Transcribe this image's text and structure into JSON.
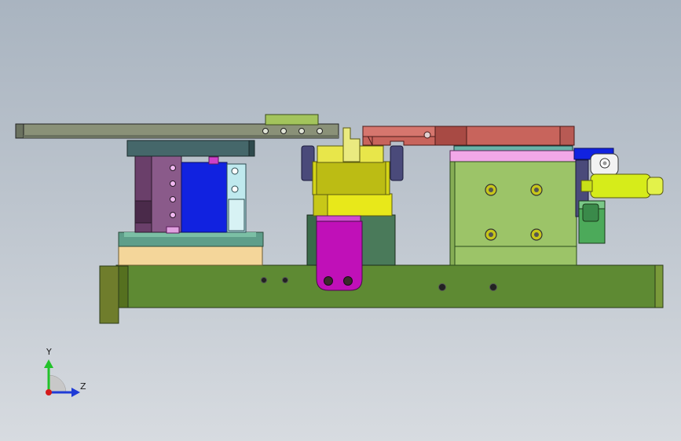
{
  "view": {
    "background_top": "#a9b4c0",
    "background_bottom": "#d7dbe0"
  },
  "triad": {
    "y_label": "Y",
    "z_label": "Z",
    "y_color": "#22c22a",
    "z_color": "#1f3bd6",
    "x_color": "#d41b1b"
  },
  "colors": {
    "base_beam": "#5e8a33",
    "end_block": "#6f7d2c",
    "top_rail": "#8a9178",
    "right_arm": "#c8645c",
    "purple_block": "#6a3f6a",
    "blue_block": "#1122e0",
    "cyan_plate": "#bfe9ee",
    "teal_plate": "#5e9e8a",
    "cream_block": "#f4d69a",
    "yellow_block": "#e8e81a",
    "magenta_clamp": "#c010b8",
    "green_block": "#9cc468",
    "pink_plate": "#f2a8e8",
    "dark_green_block": "#4a7a5a",
    "cylinder": "#d6ec1a"
  },
  "icons": [
    "triad-axes-icon",
    "cylinder-icon"
  ]
}
